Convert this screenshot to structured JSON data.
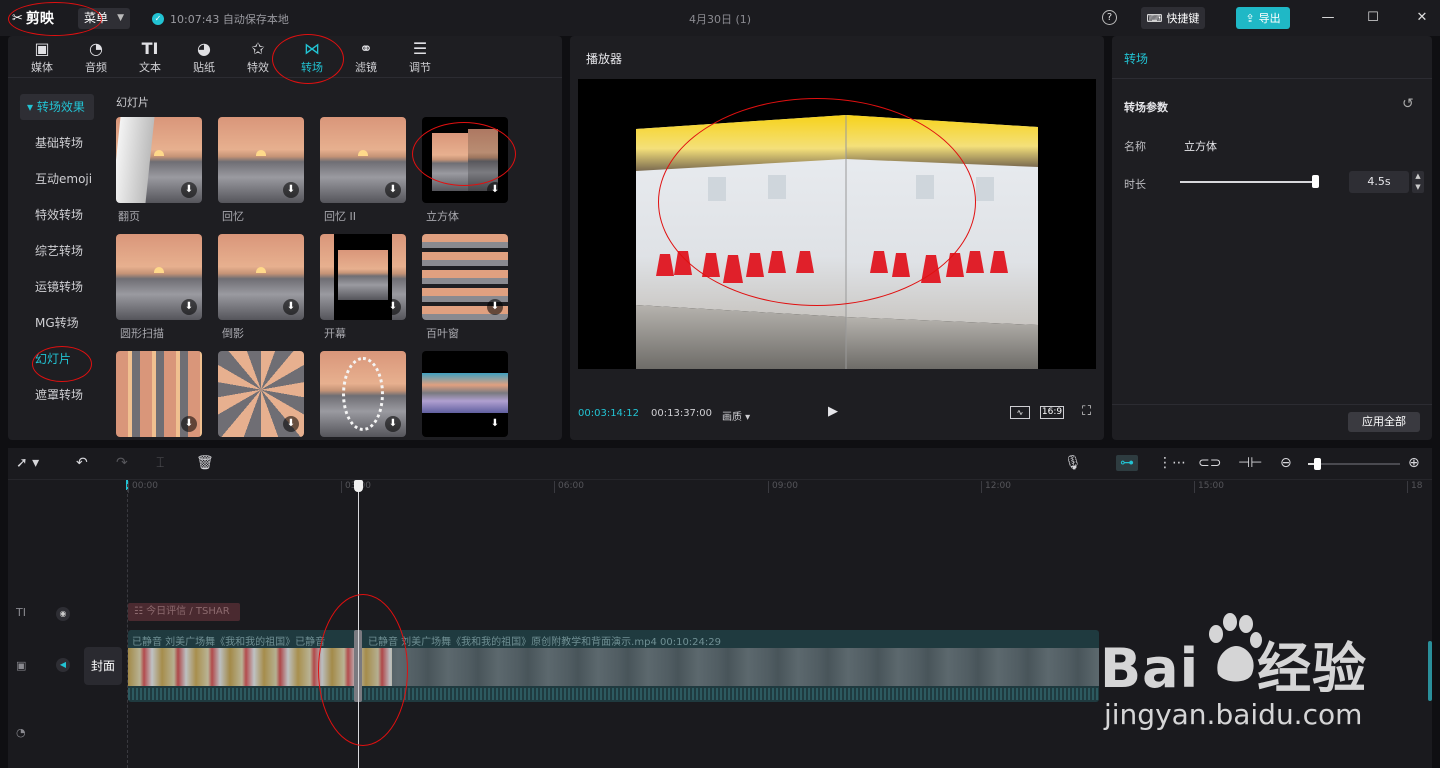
{
  "app": {
    "logo_text": "剪映",
    "menu_label": "菜单",
    "autosave_text": "10:07:43 自动保存本地",
    "document_title": "4月30日 (1)",
    "shortcut_label": "快捷键",
    "export_label": "导出"
  },
  "tool_tabs": [
    {
      "label": "媒体",
      "icon": "media-icon"
    },
    {
      "label": "音频",
      "icon": "audio-icon"
    },
    {
      "label": "文本",
      "icon": "text-icon"
    },
    {
      "label": "贴纸",
      "icon": "sticker-icon"
    },
    {
      "label": "特效",
      "icon": "effects-icon"
    },
    {
      "label": "转场",
      "icon": "transition-icon",
      "active": true
    },
    {
      "label": "滤镜",
      "icon": "filter-icon"
    },
    {
      "label": "调节",
      "icon": "adjust-icon"
    }
  ],
  "categories": [
    {
      "label": "转场效果",
      "header": true
    },
    {
      "label": "基础转场"
    },
    {
      "label": "互动emoji"
    },
    {
      "label": "特效转场"
    },
    {
      "label": "综艺转场"
    },
    {
      "label": "运镜转场"
    },
    {
      "label": "MG转场"
    },
    {
      "label": "幻灯片",
      "selected": true
    },
    {
      "label": "遮罩转场"
    }
  ],
  "grid_title": "幻灯片",
  "transitions": [
    {
      "label": "翻页"
    },
    {
      "label": "回忆"
    },
    {
      "label": "回忆 II"
    },
    {
      "label": "立方体"
    },
    {
      "label": "圆形扫描"
    },
    {
      "label": "倒影"
    },
    {
      "label": "开幕"
    },
    {
      "label": "百叶窗"
    },
    {
      "label": ""
    },
    {
      "label": ""
    },
    {
      "label": ""
    },
    {
      "label": ""
    }
  ],
  "player": {
    "title": "播放器",
    "current_time": "00:03:14:12",
    "total_time": "00:13:37:00",
    "quality_label": "画质",
    "ratio_label": "16:9"
  },
  "properties": {
    "title": "转场",
    "section_title": "转场参数",
    "name_label": "名称",
    "name_value": "立方体",
    "duration_label": "时长",
    "duration_value": "4.5s",
    "duration_fraction": 0.97,
    "apply_all_label": "应用全部"
  },
  "timeline": {
    "ruler_ticks": [
      "00:00",
      "03:00",
      "06:00",
      "09:00",
      "12:00",
      "15:00",
      "18"
    ],
    "text_clip_label": "今日评信 / TSHAR",
    "video_clip_label_1": "已静音  刘美广场舞《我和我的祖国》已静音",
    "video_clip_label_2": "已静音  刘美广场舞《我和我的祖国》原创附教学和背面演示.mp4  00:10:24:29",
    "cover_label": "封面"
  },
  "watermark": {
    "brand_a": "Bai",
    "brand_b": "经验",
    "url": "jingyan.baidu.com"
  },
  "colors": {
    "accent": "#22c3d3",
    "annotation": "#e01010"
  }
}
